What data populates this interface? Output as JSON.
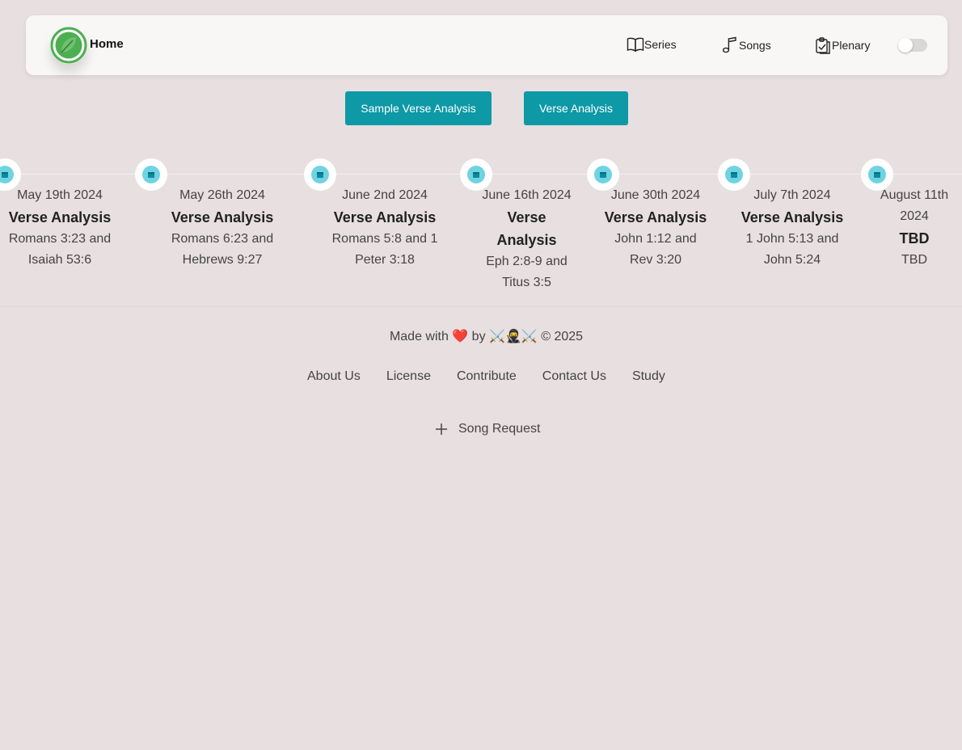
{
  "nav": {
    "brand_label": "Home",
    "items": [
      {
        "label": "Series",
        "icon": "book-open-icon"
      },
      {
        "label": "Songs",
        "icon": "music-note-icon"
      },
      {
        "label": "Plenary",
        "icon": "clipboard-check-icon"
      }
    ],
    "theme_toggle_on": false
  },
  "buttons": {
    "sample_label": "Sample Verse Analysis",
    "analysis_label": "Verse Analysis"
  },
  "timeline": [
    {
      "date": "May 19th 2024",
      "title": "Verse Analysis",
      "desc": "Romans 3:23 and Isaiah 53:6"
    },
    {
      "date": "May 26th 2024",
      "title": "Verse Analysis",
      "desc": "Romans 6:23 and Hebrews 9:27"
    },
    {
      "date": "June 2nd 2024",
      "title": "Verse Analysis",
      "desc": "Romans 5:8 and 1 Peter 3:18"
    },
    {
      "date": "June 16th 2024",
      "title": "Verse Analysis",
      "desc": "Eph 2:8-9 and Titus 3:5"
    },
    {
      "date": "June 30th 2024",
      "title": "Verse Analysis",
      "desc": "John 1:12 and Rev 3:20"
    },
    {
      "date": "July 7th 2024",
      "title": "Verse Analysis",
      "desc": "1 John 5:13 and John 5:24"
    },
    {
      "date": "August 11th 2024",
      "title": "TBD",
      "desc": "TBD"
    }
  ],
  "footer": {
    "credit": "Made with ❤️ by ⚔️🥷⚔️ © 2025",
    "links": [
      "About Us",
      "License",
      "Contribute",
      "Contact Us",
      "Study"
    ],
    "song_request": "Song Request"
  },
  "colors": {
    "background": "#e8dfe0",
    "accent": "#0d99a6",
    "timeline_dot": "#6fd3e3",
    "logo_green": "#4caf50"
  }
}
